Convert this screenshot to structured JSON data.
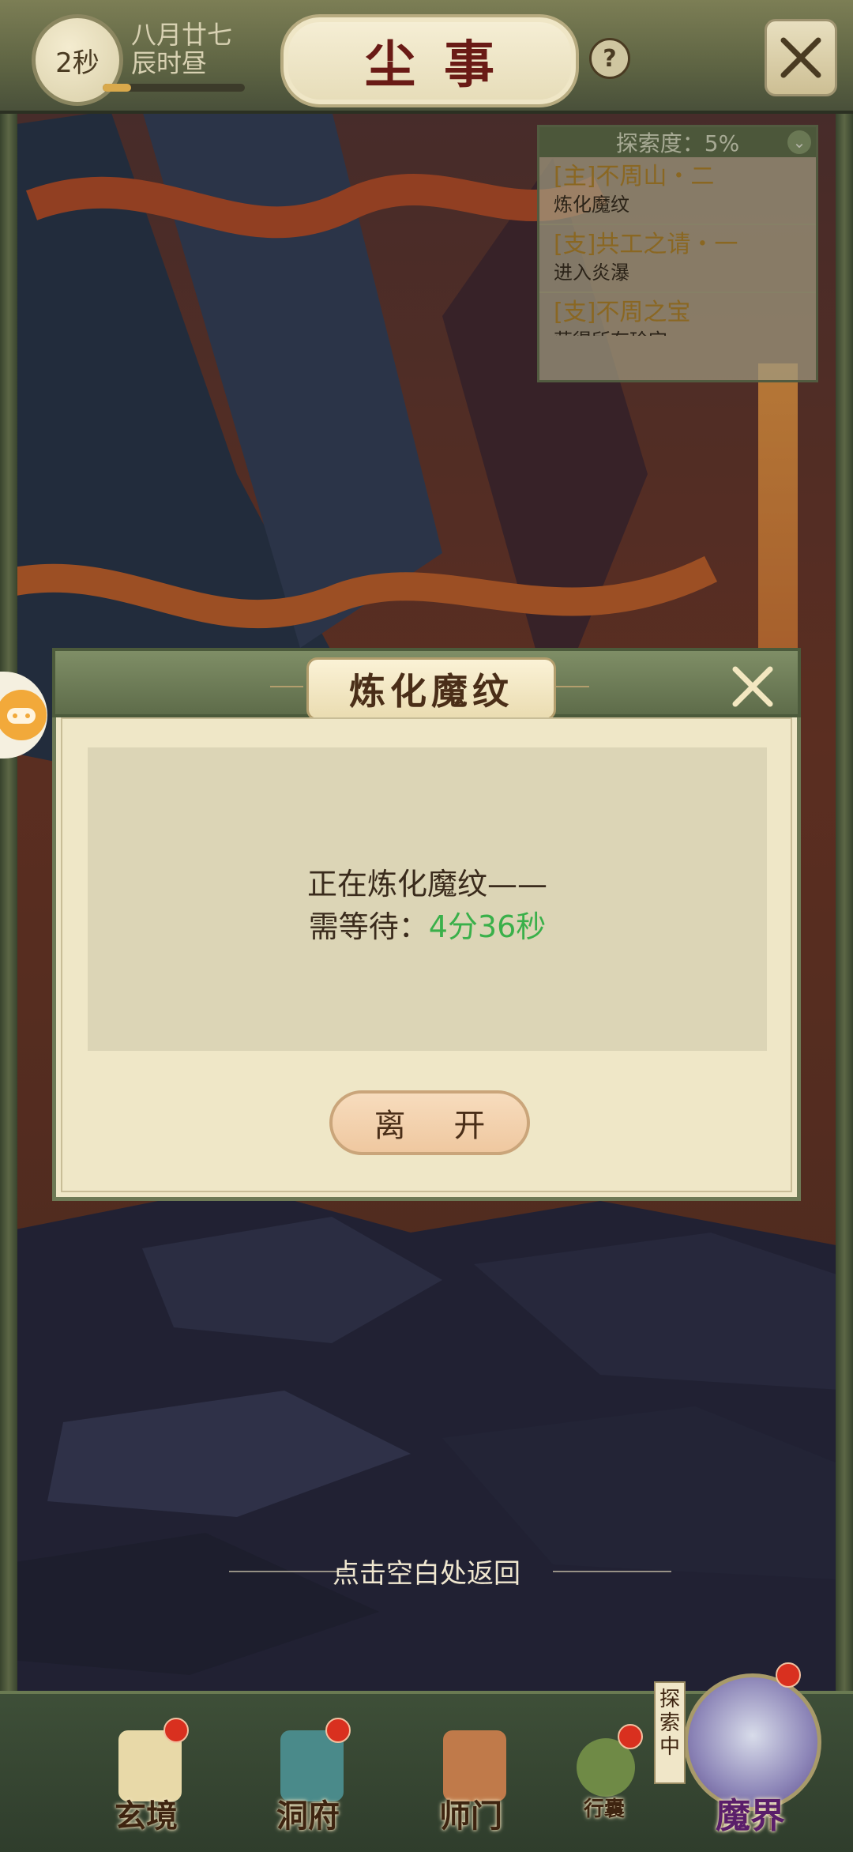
{
  "top_bar": {
    "timer": "2秒",
    "date_line1": "八月廿七",
    "date_line2": "辰时昼",
    "title": "尘事",
    "help": "?"
  },
  "quest_panel": {
    "header": "探索度：5%",
    "quests": [
      {
        "title": "[主]不周山・二",
        "desc": "炼化魔纹"
      },
      {
        "title": "[支]共工之请・一",
        "desc": "进入炎瀑"
      },
      {
        "title": "[支]不周之宝",
        "desc": "获得所有珍宝"
      }
    ]
  },
  "dialog": {
    "title": "炼化魔纹",
    "message_line1": "正在炼化魔纹——",
    "wait_label": "需等待：",
    "wait_value": "4分36秒",
    "leave_button": "离 开"
  },
  "hint": "点击空白处返回",
  "bottom_nav": {
    "items": [
      {
        "label": "玄境"
      },
      {
        "label": "洞府"
      },
      {
        "label": "师门"
      },
      {
        "label": "行囊"
      },
      {
        "label": "魔界"
      }
    ],
    "explore_tag": "探索中"
  },
  "colors": {
    "accent_green": "#3ab04a",
    "title_red": "#6a1b16",
    "quest_gold": "#b88a2e"
  }
}
